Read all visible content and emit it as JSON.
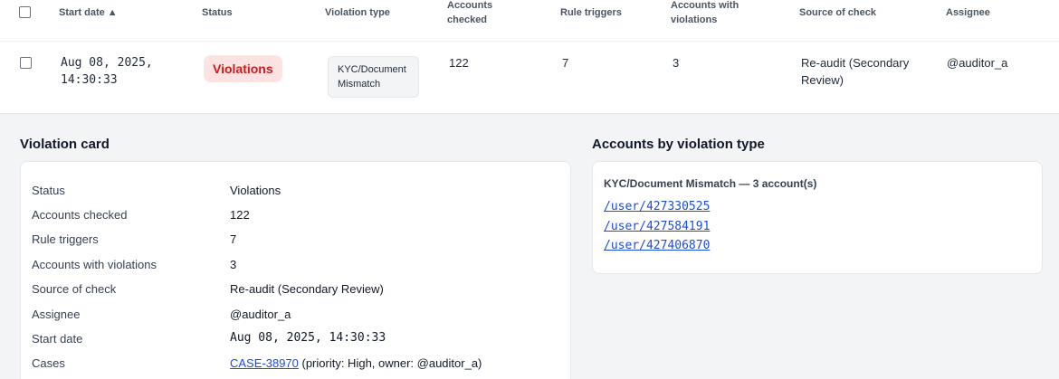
{
  "table": {
    "headers": {
      "start_date": "Start date ▲",
      "status": "Status",
      "violation_type": "Violation type",
      "accounts_checked": [
        "Accounts",
        "checked"
      ],
      "rule_triggers": "Rule triggers",
      "accounts_with_violations": [
        "Accounts with",
        "violations"
      ],
      "source_of_check": "Source of check",
      "assignee": "Assignee"
    },
    "row": {
      "start_date": [
        "Aug 08, 2025,",
        "14:30:33"
      ],
      "status": "Violations",
      "violation_type": [
        "KYC/Document",
        "Mismatch"
      ],
      "accounts_checked": "122",
      "rule_triggers": "7",
      "accounts_with_violations": "3",
      "source_of_check": [
        "Re-audit (Secondary",
        "Review)"
      ],
      "assignee": "@auditor_a"
    }
  },
  "violation_card": {
    "title": "Violation card",
    "rows": [
      {
        "label": "Status",
        "value": "Violations"
      },
      {
        "label": "Accounts checked",
        "value": "122"
      },
      {
        "label": "Rule triggers",
        "value": "7"
      },
      {
        "label": "Accounts with violations",
        "value": "3"
      },
      {
        "label": "Source of check",
        "value": "Re-audit (Secondary Review)"
      },
      {
        "label": "Assignee",
        "value": "@auditor_a"
      },
      {
        "label": "Start date",
        "value": "Aug 08, 2025, 14:30:33"
      },
      {
        "label": "Cases",
        "value": ""
      }
    ],
    "case_link": "CASE-38970",
    "case_detail": " (priority: High, owner: @auditor_a)"
  },
  "accounts_by_type": {
    "title": "Accounts by violation type",
    "group_title": "KYC/Document Mismatch — 3 account(s)",
    "accounts": [
      "/user/427330525",
      "/user/427584191",
      "/user/427406870"
    ]
  },
  "colors": {
    "status_bg": "#fde2e2",
    "status_text": "#c81e1e",
    "link": "#1d4ed8",
    "detail_bg": "#f3f4f6"
  }
}
